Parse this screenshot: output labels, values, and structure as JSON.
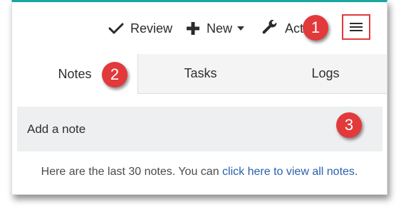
{
  "toolbar": {
    "review_label": "Review",
    "new_label": "New",
    "actions_label": "Act",
    "review_icon": "check-icon",
    "new_icon": "plus-icon",
    "actions_icon": "wrench-icon",
    "menu_icon": "hamburger-icon"
  },
  "tabs": [
    {
      "label": "Notes",
      "active": true
    },
    {
      "label": "Tasks",
      "active": false
    },
    {
      "label": "Logs",
      "active": false
    }
  ],
  "notes": {
    "placeholder": "Add a note",
    "footer_text": "Here are the last 30 notes. You can ",
    "footer_link": "click here to view all notes",
    "footer_end": "."
  },
  "callouts": [
    "1",
    "2",
    "3"
  ],
  "colors": {
    "accent_top_border": "#1aa6a0",
    "callout_red": "#e2393b",
    "link_blue": "#2a5fb0",
    "highlight_border": "#e0393d"
  }
}
